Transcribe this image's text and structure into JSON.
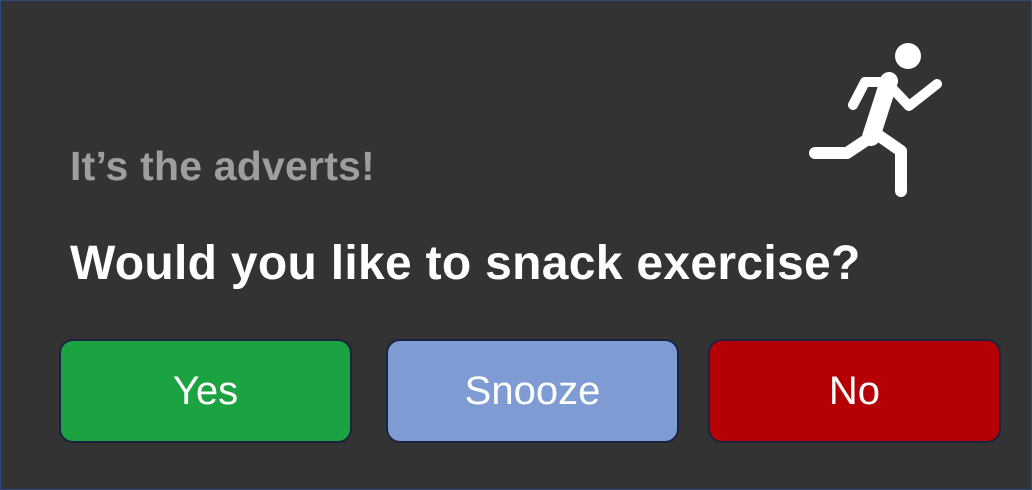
{
  "dialog": {
    "subtitle": "It’s the adverts!",
    "question": "Would you like to snack exercise?",
    "icon": "running-person-icon"
  },
  "buttons": {
    "yes": {
      "label": "Yes",
      "color": "#1aa340"
    },
    "snooze": {
      "label": "Snooze",
      "color": "#7f9bd4"
    },
    "no": {
      "label": "No",
      "color": "#b50006"
    }
  },
  "colors": {
    "background": "#333333",
    "subtitle": "#9e9e9e",
    "question": "#ffffff"
  }
}
